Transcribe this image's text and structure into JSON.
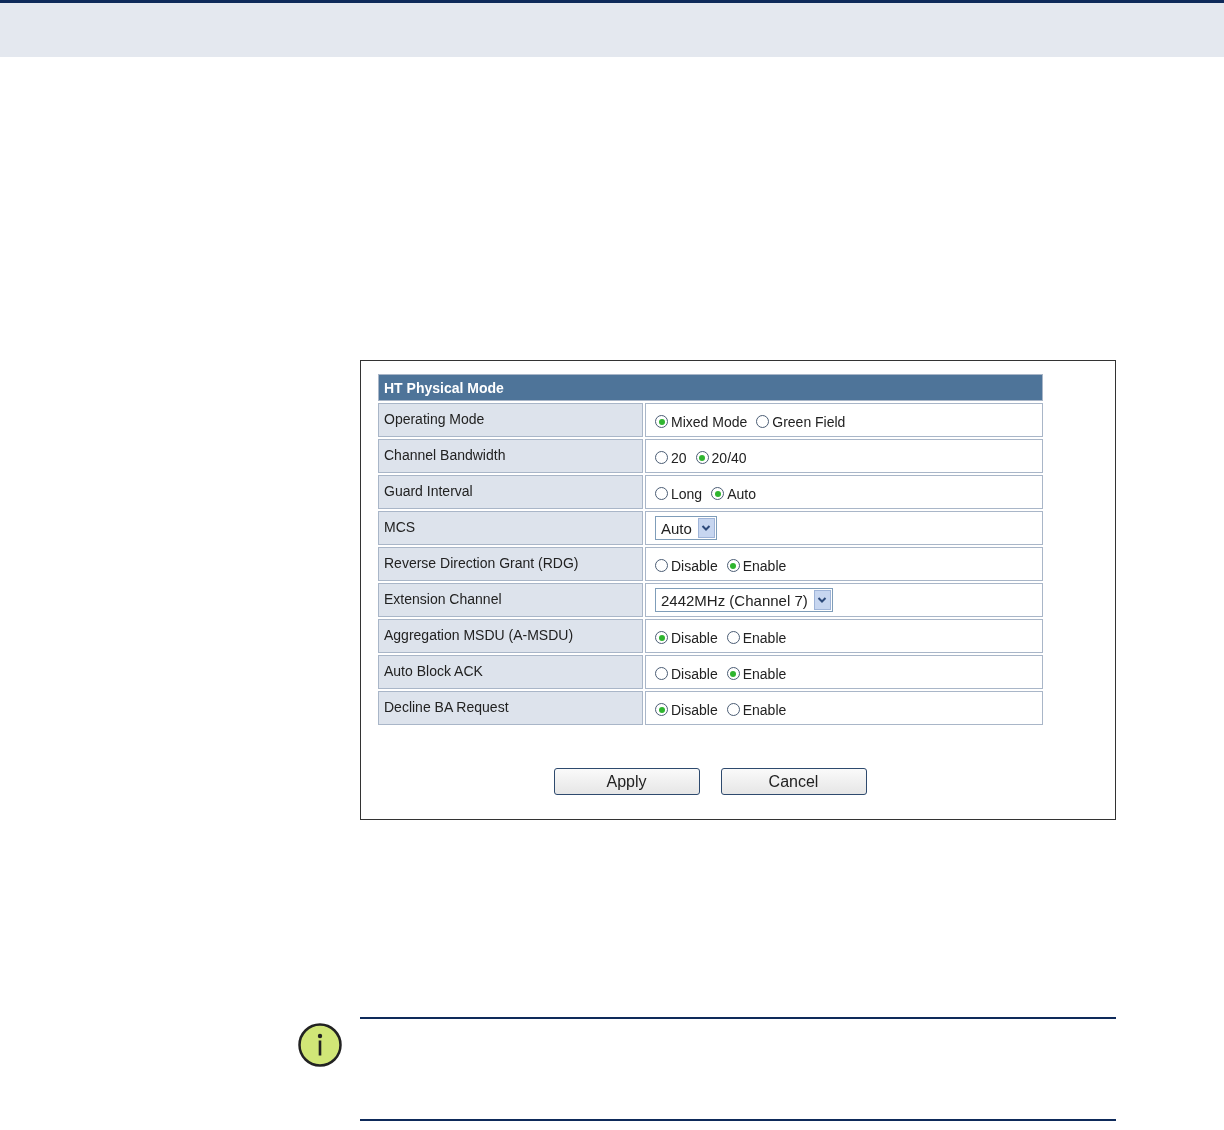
{
  "panel": {
    "title": "HT Physical Mode",
    "rows": [
      {
        "label": "Operating Mode",
        "kind": "radio",
        "options": [
          {
            "label": "Mixed Mode",
            "selected": true
          },
          {
            "label": "Green Field",
            "selected": false
          }
        ]
      },
      {
        "label": "Channel Bandwidth",
        "kind": "radio",
        "options": [
          {
            "label": "20",
            "selected": false
          },
          {
            "label": "20/40",
            "selected": true
          }
        ]
      },
      {
        "label": "Guard Interval",
        "kind": "radio",
        "options": [
          {
            "label": "Long",
            "selected": false
          },
          {
            "label": "Auto",
            "selected": true
          }
        ]
      },
      {
        "label": "MCS",
        "kind": "select",
        "value": "Auto"
      },
      {
        "label": "Reverse Direction Grant (RDG)",
        "kind": "radio",
        "options": [
          {
            "label": "Disable",
            "selected": false
          },
          {
            "label": "Enable",
            "selected": true
          }
        ]
      },
      {
        "label": "Extension Channel",
        "kind": "select",
        "value": "2442MHz (Channel 7)"
      },
      {
        "label": "Aggregation MSDU (A-MSDU)",
        "kind": "radio",
        "options": [
          {
            "label": "Disable",
            "selected": true
          },
          {
            "label": "Enable",
            "selected": false
          }
        ]
      },
      {
        "label": "Auto Block ACK",
        "kind": "radio",
        "options": [
          {
            "label": "Disable",
            "selected": false
          },
          {
            "label": "Enable",
            "selected": true
          }
        ]
      },
      {
        "label": "Decline BA Request",
        "kind": "radio",
        "options": [
          {
            "label": "Disable",
            "selected": true
          },
          {
            "label": "Enable",
            "selected": false
          }
        ]
      }
    ],
    "buttons": [
      "Apply",
      "Cancel"
    ]
  }
}
